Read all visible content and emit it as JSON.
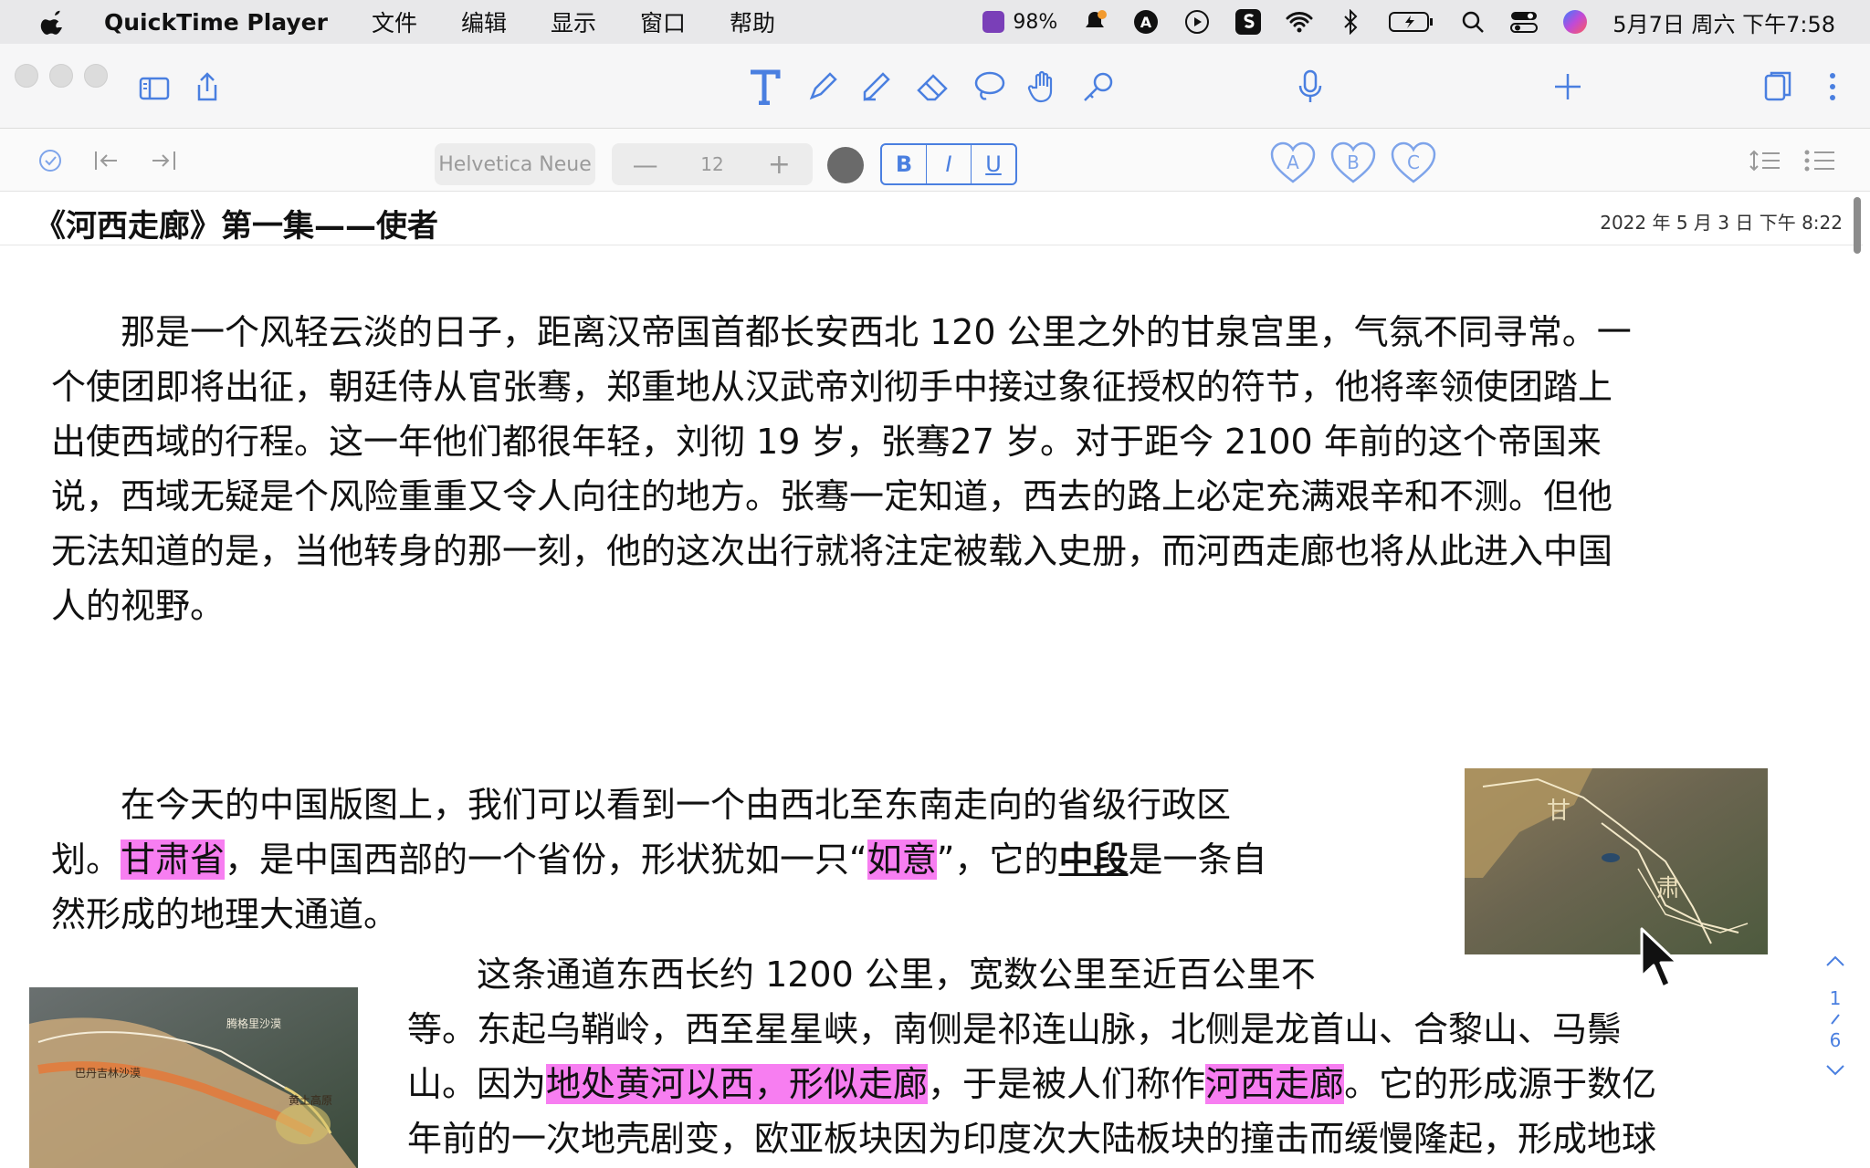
{
  "menubar": {
    "app_name": "QuickTime Player",
    "items": [
      "文件",
      "编辑",
      "显示",
      "窗口",
      "帮助"
    ],
    "battery_app_percent": "98%",
    "clock": "5月7日 周六 下午7:58"
  },
  "toolbar": {
    "font_name": "Helvetica Neue",
    "font_size": "12",
    "bold_label": "B",
    "italic_label": "I",
    "underline_label": "U",
    "heart_labels": [
      "A",
      "B",
      "C"
    ]
  },
  "document": {
    "title": "《河西走廊》第一集——使者",
    "date": "2022 年 5 月 3 日 下午 8:22",
    "para1": [
      "　　那是一个风轻云淡的日子，距离汉帝国首都长安西北 120 公里之外的甘泉宫里，气氛不同寻常。一",
      "个使团即将出征，朝廷侍从官张骞，郑重地从汉武帝刘彻手中接过象征授权的符节，他将率领使团踏上",
      "出使西域的行程。这一年他们都很年轻，刘彻 19 岁，张骞27 岁。对于距今 2100 年前的这个帝国来",
      "说，西域无疑是个风险重重又令人向往的地方。张骞一定知道，西去的路上必定充满艰辛和不测。但他",
      "无法知道的是，当他转身的那一刻，他的这次出行就将注定被载入史册，而河西走廊也将从此进入中国",
      "人的视野。"
    ],
    "para2": {
      "line1": "　　在今天的中国版图上，我们可以看到一个由西北至东南走向的省级行政区",
      "line2_a": "划。",
      "line2_hl1": "甘肃省",
      "line2_b": "，是中国西部的一个省份，形状犹如一只“",
      "line2_hl2": "如意",
      "line2_c": "”，它的",
      "line2_ul": "中段",
      "line2_d": "是一条自",
      "line3": "然形成的地理大通道。"
    },
    "para3": {
      "line1": "　　这条通道东西长约 1200 公里，宽数公里至近百公里不",
      "line2": "等。东起乌鞘岭，西至星星峡，南侧是祁连山脉，北侧是龙首山、合黎山、马鬃",
      "line3_a": "山。因为",
      "line3_hl1": "地处黄河以西，形似走廊",
      "line3_b": "，于是被人们称作",
      "line3_hl2": "河西走廊",
      "line3_c": "。它的形成源于数亿",
      "line4": "年前的一次地壳剧变，欧亚板块因为印度次大陆板块的撞击而缓慢隆起，形成地球"
    },
    "map1_labels": [
      "甘",
      "肃"
    ],
    "map2_labels": [
      "巴丹吉林沙漠",
      "腾格里沙漠",
      "黄土高原"
    ]
  },
  "pager": {
    "current": "1",
    "total": "6"
  }
}
